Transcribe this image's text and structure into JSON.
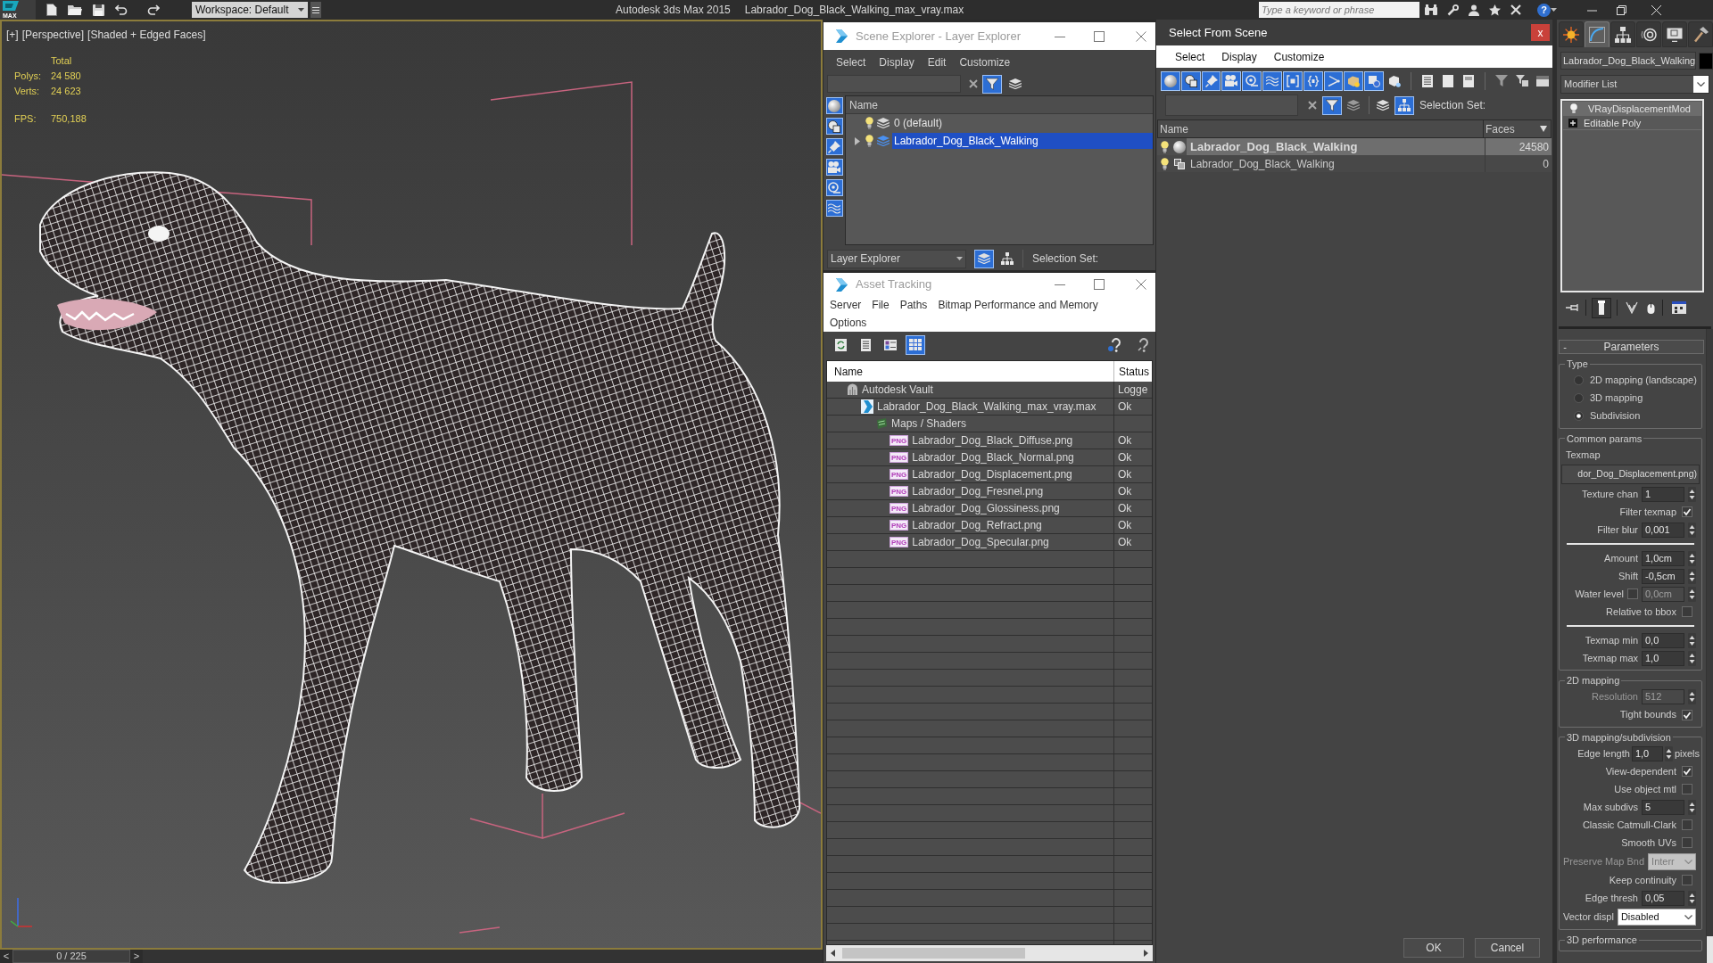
{
  "app_bar": {
    "logo": "MAX",
    "workspace": "Workspace: Default",
    "app_title": "Autodesk 3ds Max  2015",
    "file_title": "Labrador_Dog_Black_Walking_max_vray.max",
    "search": {
      "placeholder": "Type a keyword or phrase"
    },
    "help": "?"
  },
  "viewport": {
    "active": true,
    "labels": [
      "[+]",
      "[Perspective]",
      "[Shaded + Edged Faces]"
    ],
    "stats_header": "Total",
    "stats": [
      {
        "kind": "count",
        "label": "Polys:",
        "value": "24 580"
      },
      {
        "kind": "count",
        "label": "Verts:",
        "value": "24 623"
      },
      {
        "kind": "rate",
        "label": "FPS:",
        "value": "750,188"
      }
    ]
  },
  "time_slider": {
    "prev": "<",
    "frame": "0 / 225",
    "next": ">"
  },
  "scene_explorer": {
    "title": "Scene Explorer - Layer Explorer",
    "menu": [
      "Select",
      "Display",
      "Edit",
      "Customize"
    ],
    "filter_on": true,
    "categories": [
      {
        "on": true
      },
      {
        "on": true
      },
      {
        "on": true
      },
      {
        "on": true
      },
      {
        "on": true
      },
      {
        "on": true
      }
    ],
    "column": "Name",
    "layers": [
      {
        "name": "0 (default)",
        "expander": false,
        "selected": false
      },
      {
        "name": "Labrador_Dog_Black_Walking",
        "expander": true,
        "selected": true
      }
    ],
    "mode": "Layer Explorer",
    "layer_view_on": true,
    "selection_set": "Selection Set:"
  },
  "asset_tracking": {
    "title": "Asset Tracking",
    "menu": [
      "Server",
      "File",
      "Paths",
      "Bitmap Performance and Memory",
      "Options"
    ],
    "views": [
      {
        "on": false
      },
      {
        "on": false
      },
      {
        "on": false
      },
      {
        "on": true
      }
    ],
    "columns": [
      "Name",
      "Status"
    ],
    "rows": [
      {
        "kind": "vault",
        "name": "Autodesk Vault",
        "status": "Logge",
        "children": [
          {
            "kind": "scene",
            "name": "Labrador_Dog_Black_Walking_max_vray.max",
            "status": "Ok",
            "children": [
              {
                "kind": "folder",
                "name": "Maps / Shaders",
                "children": [
                  {
                    "kind": "image",
                    "badge": "PNG",
                    "name": "Labrador_Dog_Black_Diffuse.png",
                    "status": "Ok"
                  },
                  {
                    "kind": "image",
                    "badge": "PNG",
                    "name": "Labrador_Dog_Black_Normal.png",
                    "status": "Ok"
                  },
                  {
                    "kind": "image",
                    "badge": "PNG",
                    "name": "Labrador_Dog_Displacement.png",
                    "status": "Ok"
                  },
                  {
                    "kind": "image",
                    "badge": "PNG",
                    "name": "Labrador_Dog_Fresnel.png",
                    "status": "Ok"
                  },
                  {
                    "kind": "image",
                    "badge": "PNG",
                    "name": "Labrador_Dog_Glossiness.png",
                    "status": "Ok"
                  },
                  {
                    "kind": "image",
                    "badge": "PNG",
                    "name": "Labrador_Dog_Refract.png",
                    "status": "Ok"
                  },
                  {
                    "kind": "image",
                    "badge": "PNG",
                    "name": "Labrador_Dog_Specular.png",
                    "status": "Ok"
                  }
                ]
              }
            ]
          }
        ]
      }
    ]
  },
  "select_from_scene": {
    "title": "Select From Scene",
    "close": "x",
    "menu": [
      "Select",
      "Display",
      "Customize"
    ],
    "filters": [
      {
        "on": true
      },
      {
        "on": true
      },
      {
        "on": true
      },
      {
        "on": true
      },
      {
        "on": true
      },
      {
        "on": true
      },
      {
        "on": true
      },
      {
        "on": true
      },
      {
        "on": true
      },
      {
        "on": true
      },
      {
        "on": true
      },
      {
        "on": false
      }
    ],
    "toggles": [
      {
        "on": true
      },
      {
        "on": false
      },
      {
        "on": false
      },
      {
        "on": true
      }
    ],
    "selection_set": "Selection Set:",
    "columns": [
      "Name",
      "Faces"
    ],
    "rows": [
      {
        "kind": "geometry",
        "name": "Labrador_Dog_Black_Walking",
        "faces": "24580",
        "selected": true
      },
      {
        "kind": "group",
        "name": "Labrador_Dog_Black_Walking",
        "faces": "0",
        "selected": false
      }
    ],
    "buttons": [
      "OK",
      "Cancel"
    ]
  },
  "command_panel": {
    "tabs": [
      {
        "selected": false
      },
      {
        "selected": true
      },
      {
        "selected": false
      },
      {
        "selected": false
      },
      {
        "selected": false
      },
      {
        "selected": false
      }
    ],
    "object_name": "Labrador_Dog_Black_Walking",
    "modifier_list": "Modifier List",
    "stack": [
      {
        "kind": "modifier",
        "name": "VRayDisplacementMod",
        "selected": true
      },
      {
        "kind": "base",
        "name": "Editable Poly",
        "selected": false
      }
    ],
    "show_end_result": true,
    "rollout": {
      "toggle": "-",
      "title": "Parameters",
      "groups": [
        {
          "title": "Type",
          "items": [
            {
              "kind": "radio",
              "label": "2D mapping (landscape)",
              "selected": false,
              "disabled": false
            },
            {
              "kind": "radio",
              "label": "3D mapping",
              "selected": false,
              "disabled": false
            },
            {
              "kind": "radio",
              "label": "Subdivision",
              "selected": true,
              "disabled": false
            }
          ]
        },
        {
          "title": "Common params",
          "items": [
            {
              "kind": "caption",
              "label": "Texmap"
            },
            {
              "kind": "map",
              "value": "dor_Dog_Displacement.png)"
            },
            {
              "kind": "spinner",
              "label": "Texture chan",
              "value": "1",
              "disabled": false
            },
            {
              "kind": "checkbox",
              "label": "Filter texmap",
              "checked": true,
              "disabled": false
            },
            {
              "kind": "spinner",
              "label": "Filter blur",
              "value": "0,001",
              "disabled": false
            },
            {
              "kind": "separator"
            },
            {
              "kind": "spinner",
              "label": "Amount",
              "value": "1,0cm",
              "disabled": false
            },
            {
              "kind": "spinner",
              "label": "Shift",
              "value": "-0,5cm",
              "disabled": false
            },
            {
              "kind": "check_spinner",
              "label": "Water level",
              "checked": false,
              "value": "0,0cm",
              "disabled": true
            },
            {
              "kind": "checkbox",
              "label": "Relative to bbox",
              "checked": false,
              "disabled": false
            },
            {
              "kind": "separator"
            },
            {
              "kind": "spinner",
              "label": "Texmap min",
              "value": "0,0",
              "disabled": false
            },
            {
              "kind": "spinner",
              "label": "Texmap max",
              "value": "1,0",
              "disabled": false
            }
          ]
        },
        {
          "title": "2D mapping",
          "items": [
            {
              "kind": "spinner",
              "label": "Resolution",
              "value": "512",
              "disabled": true
            },
            {
              "kind": "checkbox",
              "label": "Tight bounds",
              "checked": true,
              "disabled": false
            }
          ]
        },
        {
          "title": "3D mapping/subdivision",
          "items": [
            {
              "kind": "spinner",
              "label": "Edge length",
              "value": "1,0",
              "unit": "pixels",
              "disabled": false
            },
            {
              "kind": "checkbox",
              "label": "View-dependent",
              "checked": true,
              "disabled": false
            },
            {
              "kind": "checkbox",
              "label": "Use object mtl",
              "checked": false,
              "disabled": false
            },
            {
              "kind": "spinner",
              "label": "Max subdivs",
              "value": "5",
              "disabled": false
            },
            {
              "kind": "checkbox",
              "label": "Classic Catmull-Clark",
              "checked": false,
              "disabled": false
            },
            {
              "kind": "checkbox",
              "label": "Smooth UVs",
              "checked": false,
              "disabled": false
            },
            {
              "kind": "dropdown",
              "label": "Preserve Map Bnd",
              "value": "Interr",
              "disabled": true
            },
            {
              "kind": "checkbox",
              "label": "Keep continuity",
              "checked": false,
              "disabled": false
            },
            {
              "kind": "spinner",
              "label": "Edge thresh",
              "value": "0,05",
              "disabled": false
            },
            {
              "kind": "dropdown",
              "label": "Vector displ",
              "value": "Disabled",
              "disabled": false
            }
          ]
        },
        {
          "title": "3D performance"
        }
      ]
    }
  }
}
